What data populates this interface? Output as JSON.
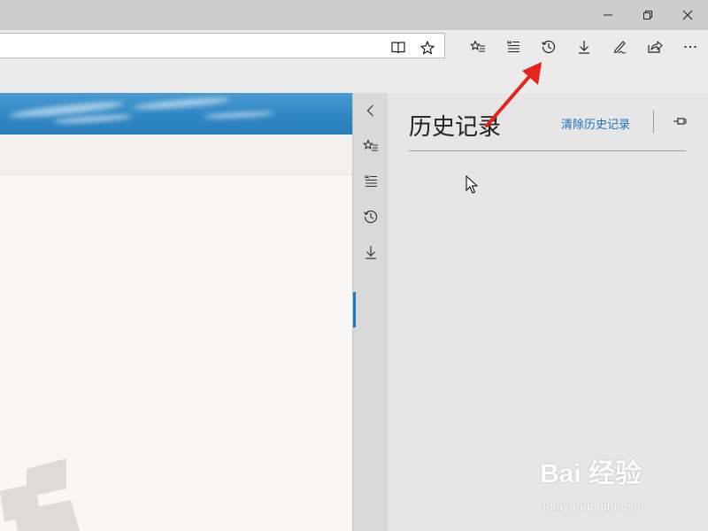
{
  "window": {
    "minimize_icon": "minimize-icon",
    "restore_icon": "restore-icon",
    "close_icon": "close-icon"
  },
  "toolbar": {
    "reading_view_icon": "reading-view-icon",
    "add_favorite_icon": "star-icon",
    "favorites_icon": "favorites-icon",
    "reading_list_icon": "reading-list-icon",
    "history_icon": "history-icon",
    "downloads_icon": "download-icon",
    "notes_icon": "pen-icon",
    "share_icon": "share-icon",
    "more_icon": "more-icon"
  },
  "hub_rail": {
    "items": [
      {
        "icon": "chevron-left-icon"
      },
      {
        "icon": "favorites-icon"
      },
      {
        "icon": "reading-list-icon"
      },
      {
        "icon": "history-icon",
        "active": true
      },
      {
        "icon": "download-icon"
      }
    ]
  },
  "history_panel": {
    "title": "历史记录",
    "clear_link": "清除历史记录",
    "pin_icon": "pin-icon"
  },
  "watermark": {
    "brand": "Bai 经验",
    "url": "jingyan.baidu.com"
  },
  "colors": {
    "accent": "#1e78c8",
    "link": "#1a6fbf",
    "annotation_arrow": "#e8231c"
  }
}
